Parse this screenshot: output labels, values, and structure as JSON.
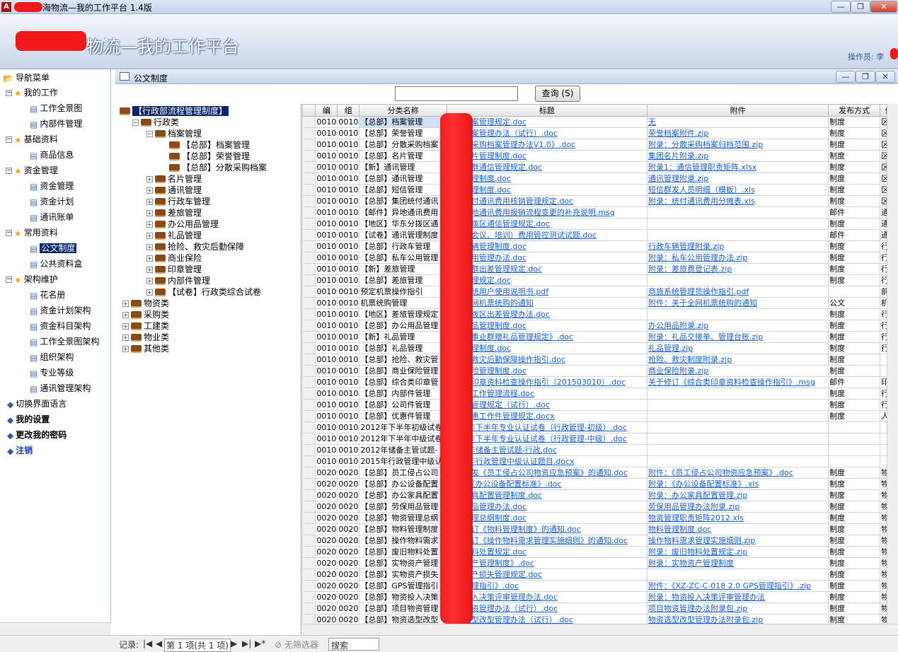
{
  "window": {
    "title_visible": "海物流—我的工作平台 1.4版",
    "banner_title": "物流—我的工作平台",
    "operator_label": "操作员: 李",
    "minimize_glyph": "—",
    "maximize_glyph": "❐",
    "close_glyph": "✕"
  },
  "nav": {
    "header": "导航菜单",
    "items": [
      {
        "label": "我的工作",
        "level": 1
      },
      {
        "label": "工作全景图",
        "level": 2
      },
      {
        "label": "内部件管理",
        "level": 2
      },
      {
        "label": "基础资料",
        "level": 1
      },
      {
        "label": "商品信息",
        "level": 2
      },
      {
        "label": "资金管理",
        "level": 1
      },
      {
        "label": "资金管理",
        "level": 2
      },
      {
        "label": "资金计划",
        "level": 2
      },
      {
        "label": "通讯账单",
        "level": 2
      },
      {
        "label": "常用资料",
        "level": 1
      },
      {
        "label": "公文制度",
        "level": 2
      },
      {
        "label": "公共资料盒",
        "level": 2
      },
      {
        "label": "架构维护",
        "level": 1
      },
      {
        "label": "花名册",
        "level": 2
      },
      {
        "label": "资金计划架构",
        "level": 2
      },
      {
        "label": "资金科目架构",
        "level": 2
      },
      {
        "label": "工作全景图架构",
        "level": 2
      },
      {
        "label": "组织架构",
        "level": 2
      },
      {
        "label": "专业等级",
        "level": 2
      },
      {
        "label": "通讯管理架构",
        "level": 2
      },
      {
        "label": "切换界面语言",
        "level": 0
      },
      {
        "label": "我的设置",
        "level": 0
      },
      {
        "label": "更改我的密码",
        "level": 0
      },
      {
        "label": "注销",
        "level": 0
      }
    ]
  },
  "child": {
    "title": "公文制度",
    "query_label": "查询 (S)",
    "search_value": ""
  },
  "tree": [
    {
      "label": "【行政部流程管理制度】",
      "x": 6,
      "type": "root"
    },
    {
      "label": "行政类",
      "x": 24,
      "sign": "−"
    },
    {
      "label": "档案管理",
      "x": 44,
      "sign": "−"
    },
    {
      "label": "【总部】档案管理",
      "x": 64,
      "sign": ""
    },
    {
      "label": "【总部】荣誉管理",
      "x": 64,
      "sign": ""
    },
    {
      "label": "【总部】分散采购档案",
      "x": 64,
      "sign": ""
    },
    {
      "label": "名片管理",
      "x": 44,
      "sign": "+"
    },
    {
      "label": "通讯管理",
      "x": 44,
      "sign": "+"
    },
    {
      "label": "行政车管理",
      "x": 44,
      "sign": "+"
    },
    {
      "label": "差旅管理",
      "x": 44,
      "sign": "+"
    },
    {
      "label": "办公用品管理",
      "x": 44,
      "sign": "+"
    },
    {
      "label": "礼品管理",
      "x": 44,
      "sign": "+"
    },
    {
      "label": "抢险、救灾后勤保障",
      "x": 44,
      "sign": "+"
    },
    {
      "label": "商业保险",
      "x": 44,
      "sign": "+"
    },
    {
      "label": "印章管理",
      "x": 44,
      "sign": "+"
    },
    {
      "label": "内部件管理",
      "x": 44,
      "sign": "+"
    },
    {
      "label": "【试卷】行政类综合试卷",
      "x": 44,
      "sign": "+"
    },
    {
      "label": "物资类",
      "x": 10,
      "sign": "+"
    },
    {
      "label": "采购类",
      "x": 10,
      "sign": "+"
    },
    {
      "label": "工建类",
      "x": 10,
      "sign": "+"
    },
    {
      "label": "物业类",
      "x": 10,
      "sign": "+"
    },
    {
      "label": "其他类",
      "x": 10,
      "sign": "+"
    }
  ],
  "grid": {
    "columns": [
      "",
      "编",
      "组",
      "分类名称",
      "标题",
      "附件",
      "发布方式",
      "使"
    ],
    "rows": [
      [
        "0010",
        "0010",
        "【总部】档案管理",
        "集团档案管理规定.doc",
        "无",
        "制度",
        "区"
      ],
      [
        "0010",
        "0010",
        "【总部】荣誉管理",
        "荣誉档案管理办法（试行）.doc",
        "荣誉档案附件.zip",
        "制度",
        "区"
      ],
      [
        "0010",
        "0010",
        "【总部】分散采购档案",
        "《分散采购档案管理办法V1.0》.doc",
        "附录：分散采购档案归档范围.zip",
        "制度",
        "区"
      ],
      [
        "0010",
        "0010",
        "【总部】名片管理",
        "集团名片管理制度.doc",
        "集团名片附录.zip",
        "制度",
        "区"
      ],
      [
        "0010",
        "0010",
        "【新】通讯管理",
        "新通讯群通信管理规定.doc",
        "附录1：通信管理职责矩阵.xlsx",
        "制度",
        "区"
      ],
      [
        "0010",
        "0010",
        "【总部】通讯管理",
        "通讯管理制度.doc",
        "通讯管理附录.zip",
        "制度",
        "区"
      ],
      [
        "0010",
        "0010",
        "【总部】短信管理",
        "短信管理制度.doc",
        "短信群发人员明细（模板）.xls",
        "制度",
        "区"
      ],
      [
        "0010",
        "0010",
        "【总部】集团统付通讯",
        "集团统付通讯费用核销管理规定.doc",
        "附录：统付通讯费用分摊表.xls",
        "制度",
        "区"
      ],
      [
        "0010",
        "0010",
        "【邮件】异地通讯费用",
        "关于异地通讯费用报销流程变更的补充说明.msg",
        "",
        "邮件",
        "通"
      ],
      [
        "0010",
        "0010",
        "【地区】华东分拨区通",
        "华东分拨区通信管理规定.doc",
        "",
        "制度",
        "通"
      ],
      [
        "0010",
        "0010",
        "【试卷】通讯管理制度",
        "关于（会议、培训）费用管控测试试题.doc",
        "",
        "邮件",
        "通"
      ],
      [
        "0010",
        "0010",
        "【总部】行政车管理",
        "行政车辆管理制度.doc",
        "行政车辆管理附录.zip",
        "制度",
        "行"
      ],
      [
        "0010",
        "0010",
        "【总部】私车公用管理",
        "私车公用管理办法.doc",
        "附录：私车公用管理办法.zip",
        "制度",
        "行"
      ],
      [
        "0010",
        "0010",
        "【新】差旅管理",
        "新差旅群出差管理规定.doc",
        "附录：差旅费登记表.zip",
        "制度",
        "行"
      ],
      [
        "0010",
        "0010",
        "【总部】差旅管理",
        "差旅管理规定.doc",
        "",
        "制度",
        "行"
      ],
      [
        "0010",
        "0010",
        "预定机票操作指引",
        "商旅系统用户使用说明书.pdf",
        "商旅系统管理员操作指引.pdf",
        "",
        "前"
      ],
      [
        "0010",
        "0010",
        "机票统购管理",
        "关于全网机票统购的通知",
        "附件：关于全网机票统购的通知",
        "公文",
        "机"
      ],
      [
        "0010",
        "0010",
        "【地区】差旅管理规定",
        "华东分拨区出差管理办法.doc",
        "",
        "制度",
        "行"
      ],
      [
        "0010",
        "0010",
        "【总部】办公用品管理",
        "办公用品管理制度.doc",
        "办公用品附录.zip",
        "制度",
        "行"
      ],
      [
        "0010",
        "0010",
        "【新】礼品管理",
        "新礼品事业群赠礼品管理规定》.doc",
        "附录：礼品交接单、管理台账.zip",
        "制度",
        "行"
      ],
      [
        "0010",
        "0010",
        "【总部】礼品管理",
        "礼品管理制度.doc",
        "礼品管理.zip",
        "制度",
        "行"
      ],
      [
        "0010",
        "0010",
        "【总部】抢险、救灾管",
        "抢险、救灾后勤保障操作指引.doc",
        "抢险、救灾制度附录.zip",
        "制度",
        ""
      ],
      [
        "0010",
        "0010",
        "【总部】商业保险管理",
        "商业保险管理制度.doc",
        "商业保险附录.zip",
        "制度",
        ""
      ],
      [
        "0010",
        "0010",
        "【总部】综合类印章管",
        "综合类印章资料检查操作指引（201503010）.doc",
        "关于修订《综合类印章资料检查操作指引》.msg",
        "邮件",
        "印"
      ],
      [
        "0010",
        "0010",
        "【总部】内部件管理",
        "内部件工作管理流程.doc",
        "",
        "制度",
        "行"
      ],
      [
        "0010",
        "0010",
        "【总部】公司件管理",
        "公司件管理规定（试行）.doc",
        "",
        "制度",
        "行"
      ],
      [
        "0010",
        "0010",
        "【总部】优惠件管理",
        "内部优惠工作件管理规定.docx",
        "",
        "制度",
        "人"
      ],
      [
        "0010",
        "0010",
        "2012年下半年初级试卷",
        "2012年下半年专业认证试卷（行政管理-初级）.doc",
        "",
        "",
        ""
      ],
      [
        "0010",
        "0010",
        "2012年下半年中级试卷",
        "2012年下半年专业认证试卷（行政管理-中级）.doc",
        "",
        "",
        ""
      ],
      [
        "0010",
        "0010",
        "2012年储备主管试题-",
        "2012年储备主管试题-行政.doc",
        "",
        "",
        ""
      ],
      [
        "0010",
        "0010",
        "2015年行政管理中级认",
        "2015年行政管理中级认证题目.docx",
        "",
        "",
        ""
      ],
      [
        "0020",
        "0020",
        "【总部】员工侵占公司",
        "关于印发《员工侵占公司物资应急预案》的通知.doc",
        "附件：《员工侵占公司物资应急预案》.doc",
        "制度",
        "物"
      ],
      [
        "0020",
        "0020",
        "【总部】办公设备配置",
        "附件：《办公设备配置标准》.doc",
        "附录：《办公设备配置标准》.xls",
        "制度",
        "物"
      ],
      [
        "0020",
        "0020",
        "【总部】办公家具配置",
        "办公家具配置管理制度.doc",
        "附录：办公家具配置管理.zip",
        "制度",
        "物"
      ],
      [
        "0020",
        "0020",
        "【总部】劳保用品管理",
        "劳保用品管理办法.doc",
        "劳保用品管理办法附录.zip",
        "制度",
        "物"
      ],
      [
        "0020",
        "0020",
        "【总部】物资管理总纲",
        "物资管理总纲制度.doc",
        "物资管理职责矩阵2012.xls",
        "制度",
        "物"
      ],
      [
        "0020",
        "0020",
        "【总部】物料管理制度",
        "关于修订《物料管理制度》的通知.doc",
        "物料管理制度.doc",
        "制度",
        "物"
      ],
      [
        "0020",
        "0020",
        "【总部】操作物料需求",
        "关于修订《操作物料需求管理实施细则》的通知.doc",
        "操作物料需求管理实施细则.zip",
        "制度",
        "物"
      ],
      [
        "0020",
        "0020",
        "【总部】废旧物料处置",
        "废旧物料处置规定.doc",
        "附录：废旧物料处置规定.zip",
        "制度",
        "物"
      ],
      [
        "0020",
        "0020",
        "【总部】实物资产管理",
        "实物资产管理制度》.doc",
        "附录：实物资产管理制度",
        "制度",
        "物"
      ],
      [
        "0020",
        "0020",
        "【总部】实物资产损失",
        "实物资产损失管理规定.doc",
        "",
        "制度",
        "物"
      ],
      [
        "0020",
        "0020",
        "【总部】GPS管理指引",
        "GPS管理指引》.doc",
        "附件：《XZ-ZC-C-018 2.0 GPS管理指引》.zip",
        "制度",
        "物"
      ],
      [
        "0020",
        "0020",
        "【总部】物资投入决策",
        "物资投入决策评审管理办法.doc",
        "附录：物资投入决策评审管理办法",
        "制度",
        "物"
      ],
      [
        "0020",
        "0020",
        "【总部】项目物资管理",
        "项目物资管理办法（试行）.doc",
        "项目物资管理办法附录包.zip",
        "制度",
        "物"
      ],
      [
        "0020",
        "0020",
        "【总部】物资选型改型",
        "物资选型改型管理办法（试行）.doc",
        "物资选型改型管理办法附录包.zip",
        "制度",
        "物"
      ]
    ]
  },
  "statusbar": {
    "record_label": "记录:",
    "nav_first": "|◀",
    "nav_prev": "◀",
    "position": "第 1 项(共 1 项)",
    "nav_next": "▶",
    "nav_last": "▶|",
    "nav_new": "▶*",
    "filter_label": "无筛选器",
    "search_label": "搜索"
  }
}
